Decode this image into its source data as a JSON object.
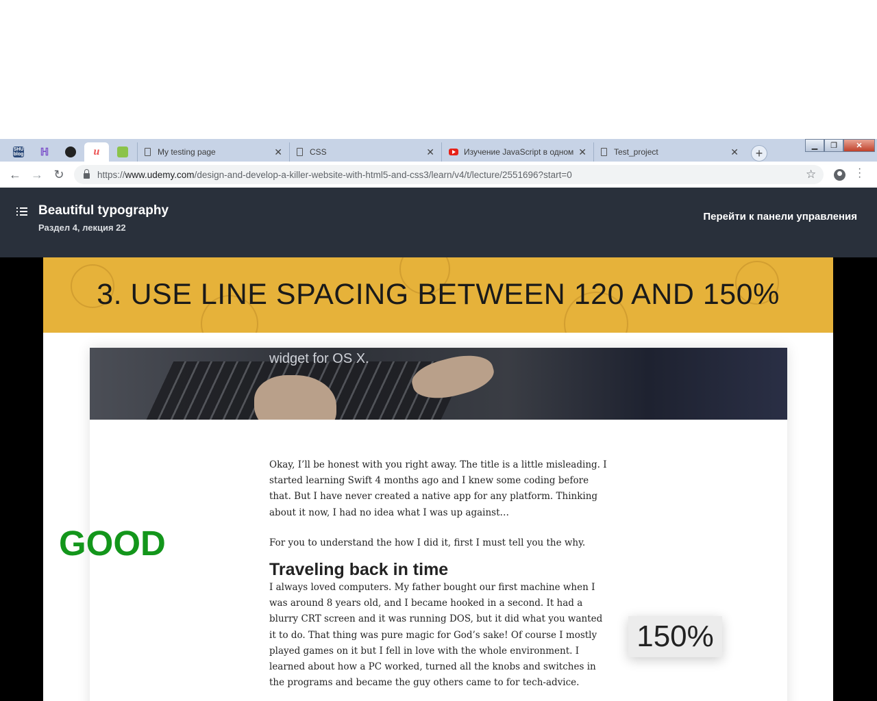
{
  "browser": {
    "pinned_tabs": [
      {
        "icon": "shu-blog-icon",
        "label": "SHU blog"
      },
      {
        "icon": "hash-icon",
        "label": ""
      },
      {
        "icon": "github-icon",
        "label": ""
      },
      {
        "icon": "udemy-icon",
        "label": "u"
      },
      {
        "icon": "green-square-icon",
        "label": ""
      }
    ],
    "tabs": [
      {
        "title": "My testing page",
        "icon": "page-icon"
      },
      {
        "title": "CSS",
        "icon": "page-icon"
      },
      {
        "title": "Изучение JavaScript в одном",
        "icon": "youtube-icon"
      },
      {
        "title": "Test_project",
        "icon": "page-icon"
      }
    ],
    "close_glyph": "✕",
    "new_tab_glyph": "+",
    "url_scheme": "https://",
    "url_host": "www.udemy.com",
    "url_path": "/design-and-develop-a-killer-website-with-html5-and-css3/learn/v4/t/lecture/2551696?start=0",
    "window_controls": {
      "minimize": "▁",
      "maximize": "❐",
      "close": "✕"
    }
  },
  "course_header": {
    "title": "Beautiful typography",
    "lecture_info": "Раздел 4, лекция 22",
    "dashboard_link": "Перейти к панели управления"
  },
  "slide": {
    "banner_title": "3. USE LINE SPACING BETWEEN 120 AND 150%",
    "hero_text": "widget for OS X.",
    "good_label": "GOOD",
    "badge": "150%",
    "article": {
      "p1": "Okay, I’ll be honest with you right away. The title is a little misleading. I started learning Swift 4 months ago and I knew some coding before that. But I have never created a native app for any platform. Thinking about it now, I had no idea what I was up against…",
      "p2": "For you to understand the how I did it, first I must tell you the why.",
      "heading": "Traveling back in time",
      "p3": "I always loved computers. My father bought our first machine when I was around 8 years old, and I became hooked in a second. It had a blurry CRT screen and it was running DOS, but it did what you wanted it to do. That thing was pure magic for God’s sake! Of course I mostly played games on it but I fell in love with the whole environment. I learned about how a PC worked, turned all the knobs and switches in the programs and became the guy others came to for tech-advice."
    }
  },
  "colors": {
    "tab_strip": "#c7d3e6",
    "header_bg": "#29303b",
    "banner": "#e6b23a",
    "good_green": "#13961b"
  }
}
